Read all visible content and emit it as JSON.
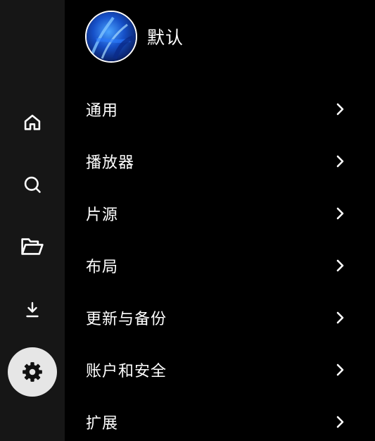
{
  "profile": {
    "name": "默认"
  },
  "sidebar": {
    "items": [
      {
        "icon": "home-icon"
      },
      {
        "icon": "search-icon"
      },
      {
        "icon": "folder-open-icon"
      },
      {
        "icon": "download-icon"
      },
      {
        "icon": "gear-icon",
        "active": true
      }
    ]
  },
  "settings": {
    "items": [
      {
        "label": "通用"
      },
      {
        "label": "播放器"
      },
      {
        "label": "片源"
      },
      {
        "label": "布局"
      },
      {
        "label": "更新与备份"
      },
      {
        "label": "账户和安全"
      },
      {
        "label": "扩展"
      }
    ]
  },
  "colors": {
    "background": "#000000",
    "sidebar": "#161616",
    "active_nav": "#e6e6e6",
    "text": "#ffffff"
  }
}
